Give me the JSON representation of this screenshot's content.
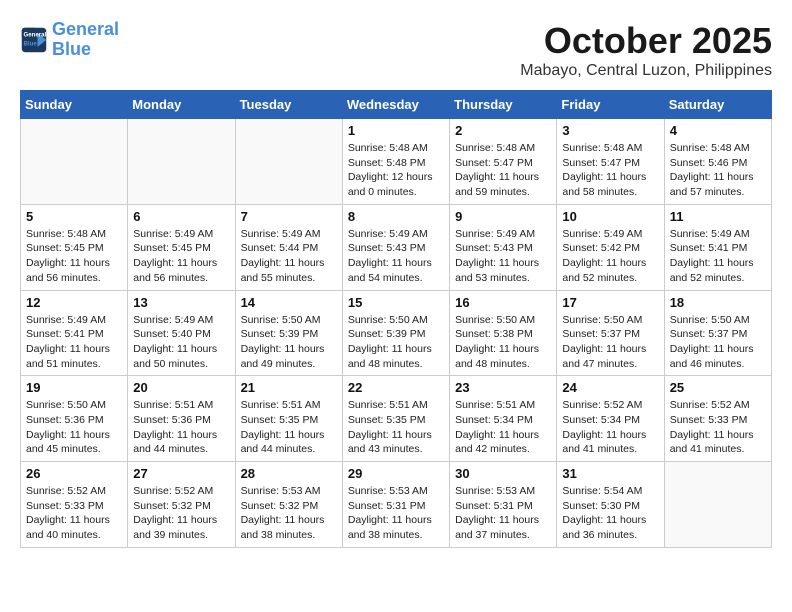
{
  "header": {
    "logo_line1": "General",
    "logo_line2": "Blue",
    "month": "October 2025",
    "location": "Mabayo, Central Luzon, Philippines"
  },
  "days_of_week": [
    "Sunday",
    "Monday",
    "Tuesday",
    "Wednesday",
    "Thursday",
    "Friday",
    "Saturday"
  ],
  "weeks": [
    [
      {
        "day": "",
        "info": ""
      },
      {
        "day": "",
        "info": ""
      },
      {
        "day": "",
        "info": ""
      },
      {
        "day": "1",
        "info": "Sunrise: 5:48 AM\nSunset: 5:48 PM\nDaylight: 12 hours\nand 0 minutes."
      },
      {
        "day": "2",
        "info": "Sunrise: 5:48 AM\nSunset: 5:47 PM\nDaylight: 11 hours\nand 59 minutes."
      },
      {
        "day": "3",
        "info": "Sunrise: 5:48 AM\nSunset: 5:47 PM\nDaylight: 11 hours\nand 58 minutes."
      },
      {
        "day": "4",
        "info": "Sunrise: 5:48 AM\nSunset: 5:46 PM\nDaylight: 11 hours\nand 57 minutes."
      }
    ],
    [
      {
        "day": "5",
        "info": "Sunrise: 5:48 AM\nSunset: 5:45 PM\nDaylight: 11 hours\nand 56 minutes."
      },
      {
        "day": "6",
        "info": "Sunrise: 5:49 AM\nSunset: 5:45 PM\nDaylight: 11 hours\nand 56 minutes."
      },
      {
        "day": "7",
        "info": "Sunrise: 5:49 AM\nSunset: 5:44 PM\nDaylight: 11 hours\nand 55 minutes."
      },
      {
        "day": "8",
        "info": "Sunrise: 5:49 AM\nSunset: 5:43 PM\nDaylight: 11 hours\nand 54 minutes."
      },
      {
        "day": "9",
        "info": "Sunrise: 5:49 AM\nSunset: 5:43 PM\nDaylight: 11 hours\nand 53 minutes."
      },
      {
        "day": "10",
        "info": "Sunrise: 5:49 AM\nSunset: 5:42 PM\nDaylight: 11 hours\nand 52 minutes."
      },
      {
        "day": "11",
        "info": "Sunrise: 5:49 AM\nSunset: 5:41 PM\nDaylight: 11 hours\nand 52 minutes."
      }
    ],
    [
      {
        "day": "12",
        "info": "Sunrise: 5:49 AM\nSunset: 5:41 PM\nDaylight: 11 hours\nand 51 minutes."
      },
      {
        "day": "13",
        "info": "Sunrise: 5:49 AM\nSunset: 5:40 PM\nDaylight: 11 hours\nand 50 minutes."
      },
      {
        "day": "14",
        "info": "Sunrise: 5:50 AM\nSunset: 5:39 PM\nDaylight: 11 hours\nand 49 minutes."
      },
      {
        "day": "15",
        "info": "Sunrise: 5:50 AM\nSunset: 5:39 PM\nDaylight: 11 hours\nand 48 minutes."
      },
      {
        "day": "16",
        "info": "Sunrise: 5:50 AM\nSunset: 5:38 PM\nDaylight: 11 hours\nand 48 minutes."
      },
      {
        "day": "17",
        "info": "Sunrise: 5:50 AM\nSunset: 5:37 PM\nDaylight: 11 hours\nand 47 minutes."
      },
      {
        "day": "18",
        "info": "Sunrise: 5:50 AM\nSunset: 5:37 PM\nDaylight: 11 hours\nand 46 minutes."
      }
    ],
    [
      {
        "day": "19",
        "info": "Sunrise: 5:50 AM\nSunset: 5:36 PM\nDaylight: 11 hours\nand 45 minutes."
      },
      {
        "day": "20",
        "info": "Sunrise: 5:51 AM\nSunset: 5:36 PM\nDaylight: 11 hours\nand 44 minutes."
      },
      {
        "day": "21",
        "info": "Sunrise: 5:51 AM\nSunset: 5:35 PM\nDaylight: 11 hours\nand 44 minutes."
      },
      {
        "day": "22",
        "info": "Sunrise: 5:51 AM\nSunset: 5:35 PM\nDaylight: 11 hours\nand 43 minutes."
      },
      {
        "day": "23",
        "info": "Sunrise: 5:51 AM\nSunset: 5:34 PM\nDaylight: 11 hours\nand 42 minutes."
      },
      {
        "day": "24",
        "info": "Sunrise: 5:52 AM\nSunset: 5:34 PM\nDaylight: 11 hours\nand 41 minutes."
      },
      {
        "day": "25",
        "info": "Sunrise: 5:52 AM\nSunset: 5:33 PM\nDaylight: 11 hours\nand 41 minutes."
      }
    ],
    [
      {
        "day": "26",
        "info": "Sunrise: 5:52 AM\nSunset: 5:33 PM\nDaylight: 11 hours\nand 40 minutes."
      },
      {
        "day": "27",
        "info": "Sunrise: 5:52 AM\nSunset: 5:32 PM\nDaylight: 11 hours\nand 39 minutes."
      },
      {
        "day": "28",
        "info": "Sunrise: 5:53 AM\nSunset: 5:32 PM\nDaylight: 11 hours\nand 38 minutes."
      },
      {
        "day": "29",
        "info": "Sunrise: 5:53 AM\nSunset: 5:31 PM\nDaylight: 11 hours\nand 38 minutes."
      },
      {
        "day": "30",
        "info": "Sunrise: 5:53 AM\nSunset: 5:31 PM\nDaylight: 11 hours\nand 37 minutes."
      },
      {
        "day": "31",
        "info": "Sunrise: 5:54 AM\nSunset: 5:30 PM\nDaylight: 11 hours\nand 36 minutes."
      },
      {
        "day": "",
        "info": ""
      }
    ]
  ]
}
